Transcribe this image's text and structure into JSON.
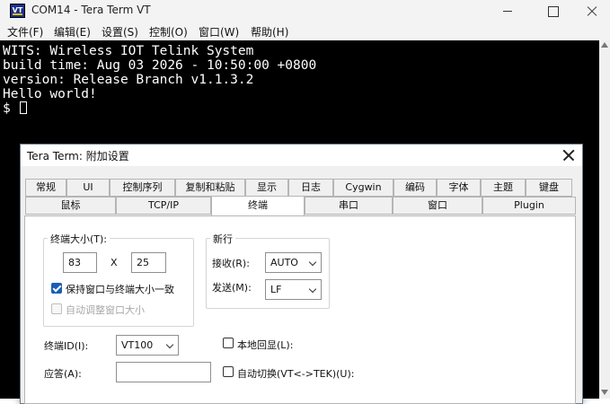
{
  "window": {
    "title": "COM14 - Tera Term VT",
    "icon_text": "VT",
    "menu": [
      "文件(F)",
      "编辑(E)",
      "设置(S)",
      "控制(O)",
      "窗口(W)",
      "帮助(H)"
    ]
  },
  "terminal": {
    "lines": [
      "WITS: Wireless IOT Telink System",
      "build time: Aug 03 2026 - 10:50:00 +0800",
      "version: Release Branch v1.1.3.2",
      "Hello world!",
      "$ "
    ]
  },
  "dialog": {
    "title": "Tera Term: 附加设置",
    "tabs_row1": [
      "常规",
      "UI",
      "控制序列",
      "复制和粘贴",
      "显示",
      "日志",
      "Cygwin",
      "编码",
      "字体",
      "主题",
      "键盘"
    ],
    "tabs_row2": [
      "鼠标",
      "TCP/IP",
      "终端",
      "串口",
      "窗口",
      "Plugin"
    ],
    "active_tab": "终端",
    "terminal_size": {
      "legend": "终端大小(T):",
      "cols": "83",
      "x_label": "X",
      "rows": "25",
      "keep_label": "保持窗口与终端大小一致",
      "keep_checked": true,
      "auto_resize_label": "自动调整窗口大小",
      "auto_resize_checked": false
    },
    "newline": {
      "legend": "新行",
      "receive_label": "接收(R):",
      "receive_value": "AUTO",
      "send_label": "发送(M):",
      "send_value": "LF"
    },
    "terminal_id_label": "终端ID(I):",
    "terminal_id_value": "VT100",
    "local_echo_label": "本地回显(L):",
    "answerback_label": "应答(A):",
    "answerback_value": "",
    "auto_switch_label": "自动切换(VT<->TEK)(U):"
  },
  "colors": {
    "terminal_bg": "#000000",
    "terminal_fg": "#ffffff",
    "checkbox_accent": "#1a5fb4"
  }
}
